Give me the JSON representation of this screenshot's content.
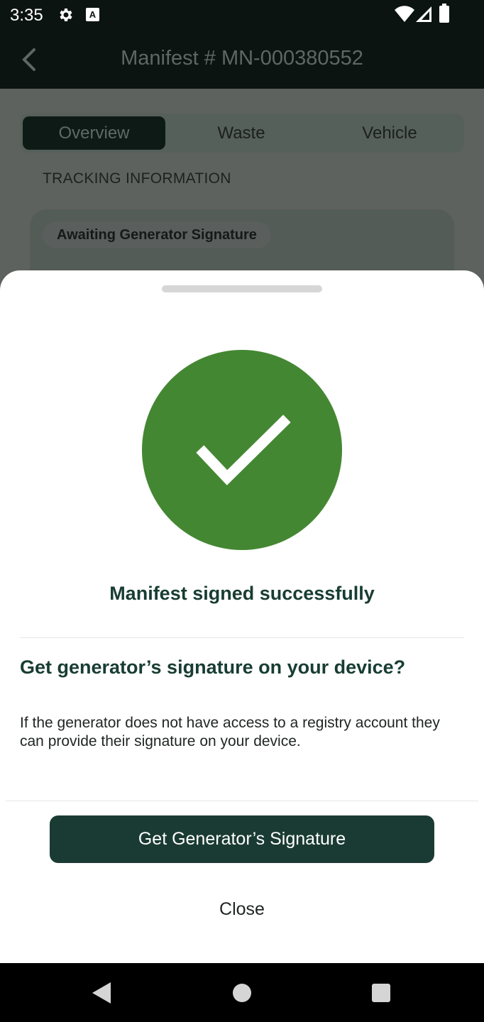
{
  "status_bar": {
    "time": "3:35",
    "icons": [
      "gear-icon",
      "a-icon",
      "wifi-icon",
      "signal-icon",
      "battery-icon"
    ],
    "a_glyph": "A"
  },
  "app_bar": {
    "title": "Manifest # MN-000380552",
    "back_icon": "chevron-left-icon"
  },
  "tabs": [
    {
      "label": "Overview",
      "active": true
    },
    {
      "label": "Waste",
      "active": false
    },
    {
      "label": "Vehicle",
      "active": false
    }
  ],
  "tracking": {
    "section_label": "TRACKING INFORMATION",
    "status": "Awaiting Generator Signature"
  },
  "sheet": {
    "success_icon": "checkmark-icon",
    "success_title": "Manifest signed successfully",
    "question": "Get generator’s signature on your device?",
    "description": "If the generator does not have access to a registry account they can provide their signature on your device.",
    "primary_button": "Get Generator’s Signature",
    "close_button": "Close"
  },
  "colors": {
    "primary": "#1a3b33",
    "success": "#448732",
    "heading": "#183d32"
  },
  "nav_bar": {
    "icons": [
      "nav-back-icon",
      "nav-home-icon",
      "nav-recents-icon"
    ]
  }
}
